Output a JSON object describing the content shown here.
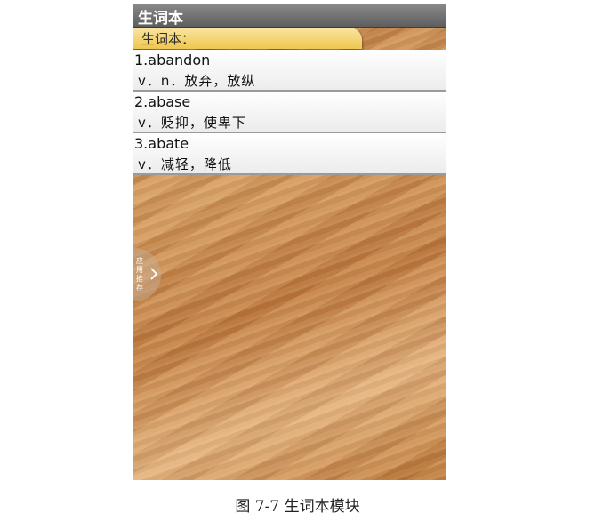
{
  "app": {
    "title": "生词本"
  },
  "section": {
    "label": "生词本："
  },
  "vocab_list": [
    {
      "word": "1.abandon",
      "meaning": "v．n．放弃，放纵"
    },
    {
      "word": "2.abase",
      "meaning": "v．贬抑，使卑下"
    },
    {
      "word": "3.abate",
      "meaning": "v．减轻，降低"
    }
  ],
  "side_tab": {
    "label": "应用推荐",
    "icon": "chevron-right-icon"
  },
  "caption": "图 7-7  生词本模块"
}
